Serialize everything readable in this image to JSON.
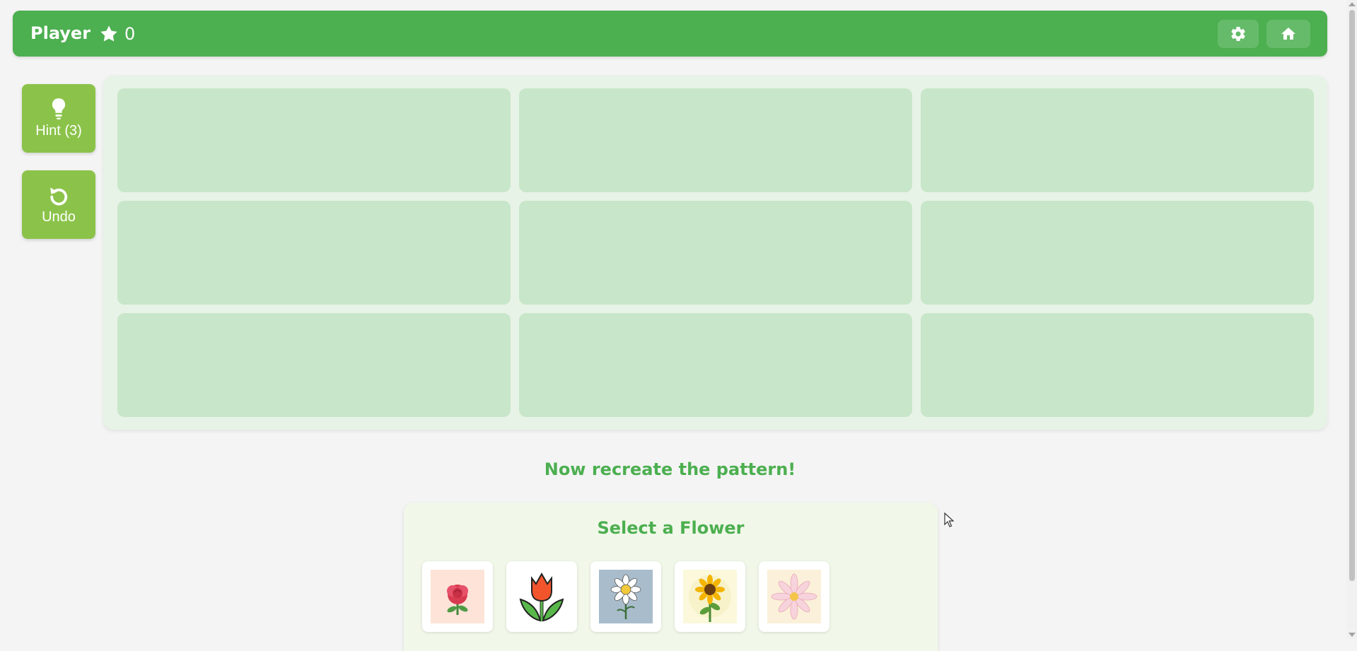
{
  "header": {
    "player_name": "Player",
    "score": "0",
    "score_icon": "star-icon",
    "settings_icon": "gear-icon",
    "home_icon": "home-icon"
  },
  "sidebar": {
    "hint_label": "Hint (3)",
    "hint_icon": "lightbulb-icon",
    "undo_label": "Undo",
    "undo_icon": "undo-icon"
  },
  "board": {
    "rows": 3,
    "cols": 3,
    "cells": [
      "",
      "",
      "",
      "",
      "",
      "",
      "",
      "",
      ""
    ]
  },
  "instruction": "Now recreate the pattern!",
  "selector": {
    "title": "Select a Flower",
    "flowers": [
      {
        "name": "rose",
        "icon": "rose-icon"
      },
      {
        "name": "tulip",
        "icon": "tulip-icon"
      },
      {
        "name": "daisy",
        "icon": "daisy-icon"
      },
      {
        "name": "sunflower",
        "icon": "sunflower-icon"
      },
      {
        "name": "lily",
        "icon": "lily-icon"
      }
    ]
  },
  "colors": {
    "primary": "#4caf50",
    "accent": "#8bc34a",
    "cell": "#c8e6c9",
    "panel": "#e7f3e6",
    "background": "#f4f4f4"
  }
}
